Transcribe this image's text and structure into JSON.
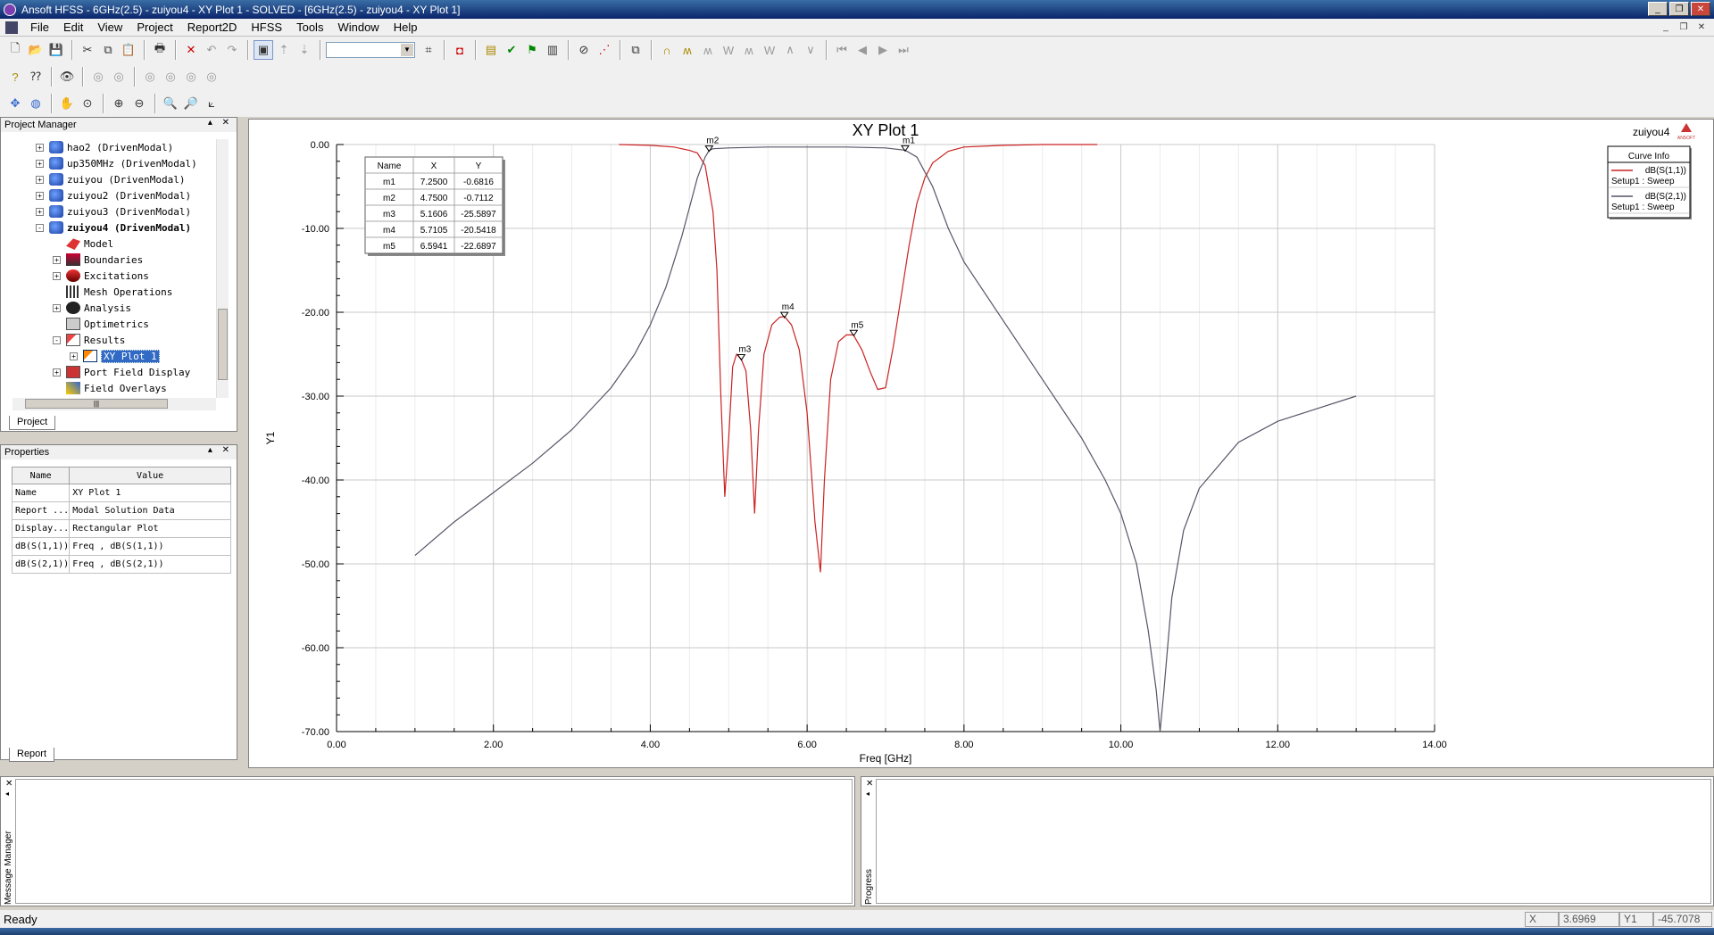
{
  "window": {
    "title": "Ansoft HFSS - 6GHz(2.5) - zuiyou4 - XY Plot 1 - SOLVED - [6GHz(2.5) - zuiyou4 - XY Plot 1]"
  },
  "menu": [
    "File",
    "Edit",
    "View",
    "Project",
    "Report2D",
    "HFSS",
    "Tools",
    "Window",
    "Help"
  ],
  "project_manager": {
    "title": "Project Manager",
    "tab": "Project",
    "items": [
      {
        "label": "hao2 (DrivenModal)",
        "icon": "solid-icon",
        "level": 0,
        "exp": "+"
      },
      {
        "label": "up350MHz (DrivenModal)",
        "icon": "solid-icon",
        "level": 0,
        "exp": "+"
      },
      {
        "label": "zuiyou (DrivenModal)",
        "icon": "solid-icon",
        "level": 0,
        "exp": "+"
      },
      {
        "label": "zuiyou2 (DrivenModal)",
        "icon": "solid-icon",
        "level": 0,
        "exp": "+"
      },
      {
        "label": "zuiyou3 (DrivenModal)",
        "icon": "solid-icon",
        "level": 0,
        "exp": "+"
      },
      {
        "label": "zuiyou4 (DrivenModal)",
        "icon": "solid-icon",
        "level": 0,
        "exp": "-",
        "bold": true
      },
      {
        "label": "Model",
        "icon": "model-icon",
        "level": 1,
        "exp": ""
      },
      {
        "label": "Boundaries",
        "icon": "boundaries-icon",
        "level": 1,
        "exp": "+"
      },
      {
        "label": "Excitations",
        "icon": "excitations-icon",
        "level": 1,
        "exp": "+"
      },
      {
        "label": "Mesh Operations",
        "icon": "mesh-icon",
        "level": 1,
        "exp": ""
      },
      {
        "label": "Analysis",
        "icon": "analysis-icon",
        "level": 1,
        "exp": "+"
      },
      {
        "label": "Optimetrics",
        "icon": "optimetrics-icon",
        "level": 1,
        "exp": ""
      },
      {
        "label": "Results",
        "icon": "results-icon",
        "level": 1,
        "exp": "-"
      },
      {
        "label": "XY Plot 1",
        "icon": "xy-plot-icon",
        "level": 2,
        "exp": "+",
        "selected": true
      },
      {
        "label": "Port Field Display",
        "icon": "port-field-icon",
        "level": 1,
        "exp": "+"
      },
      {
        "label": "Field Overlays",
        "icon": "field-overlays-icon",
        "level": 1,
        "exp": ""
      }
    ]
  },
  "properties": {
    "title": "Properties",
    "tab": "Report",
    "headers": [
      "Name",
      "Value"
    ],
    "rows": [
      [
        "Name",
        "XY Plot 1"
      ],
      [
        "Report ...",
        "Modal Solution Data"
      ],
      [
        "Display...",
        "Rectangular Plot"
      ],
      [
        "dB(S(1,1))",
        "Freq , dB(S(1,1))"
      ],
      [
        "dB(S(2,1))",
        "Freq , dB(S(2,1))"
      ]
    ]
  },
  "plot": {
    "title": "XY Plot 1",
    "design_label": "zuiyou4",
    "logo_text": "ANSOFT",
    "xlabel": "Freq [GHz]",
    "ylabel": "Y1",
    "curve_info_title": "Curve Info",
    "marker_table": {
      "headers": [
        "Name",
        "X",
        "Y"
      ],
      "rows": [
        [
          "m1",
          "7.2500",
          "-0.6816"
        ],
        [
          "m2",
          "4.7500",
          "-0.7112"
        ],
        [
          "m3",
          "5.1606",
          "-25.5897"
        ],
        [
          "m4",
          "5.7105",
          "-20.5418"
        ],
        [
          "m5",
          "6.5941",
          "-22.6897"
        ]
      ]
    }
  },
  "chart_data": {
    "type": "line",
    "title": "XY Plot 1",
    "xlabel": "Freq [GHz]",
    "ylabel": "Y1",
    "xlim": [
      0,
      14
    ],
    "ylim": [
      -70,
      0
    ],
    "xticks": [
      "0.00",
      "2.00",
      "4.00",
      "6.00",
      "8.00",
      "10.00",
      "12.00",
      "14.00"
    ],
    "yticks": [
      "0.00",
      "-10.00",
      "-20.00",
      "-30.00",
      "-40.00",
      "-50.00",
      "-60.00",
      "-70.00"
    ],
    "grid": true,
    "legend_position": "top-right",
    "series": [
      {
        "name": "dB(S(1,1))",
        "sub": "Setup1 : Sweep",
        "color": "#cc2222",
        "x": [
          3.6,
          4.0,
          4.3,
          4.5,
          4.6,
          4.7,
          4.8,
          4.85,
          4.9,
          4.95,
          5.0,
          5.05,
          5.1,
          5.16,
          5.22,
          5.28,
          5.33,
          5.38,
          5.45,
          5.55,
          5.65,
          5.71,
          5.8,
          5.9,
          6.0,
          6.1,
          6.17,
          6.22,
          6.3,
          6.4,
          6.5,
          6.59,
          6.7,
          6.8,
          6.9,
          7.0,
          7.1,
          7.2,
          7.3,
          7.4,
          7.5,
          7.6,
          7.8,
          8.0,
          8.5,
          9.0,
          9.7
        ],
        "y": [
          0,
          -0.1,
          -0.3,
          -0.7,
          -1.0,
          -2.5,
          -8.0,
          -15.0,
          -30.0,
          -42.0,
          -35.0,
          -26.5,
          -25.0,
          -25.6,
          -27.0,
          -34.0,
          -44.0,
          -34.0,
          -25.0,
          -21.5,
          -20.6,
          -20.5,
          -21.5,
          -24.5,
          -32.0,
          -45.0,
          -51.0,
          -40.0,
          -28.0,
          -23.5,
          -22.7,
          -22.7,
          -24.5,
          -27.0,
          -29.2,
          -29.0,
          -24.0,
          -18.0,
          -12.0,
          -7.0,
          -4.0,
          -2.2,
          -0.8,
          -0.3,
          -0.1,
          0,
          0
        ]
      },
      {
        "name": "dB(S(2,1))",
        "sub": "Setup1 : Sweep",
        "color": "#555566",
        "x": [
          1.0,
          1.5,
          2.0,
          2.5,
          3.0,
          3.5,
          3.8,
          4.0,
          4.2,
          4.4,
          4.5,
          4.6,
          4.7,
          4.75,
          4.8,
          5.0,
          5.5,
          6.0,
          6.5,
          7.0,
          7.25,
          7.4,
          7.6,
          7.8,
          8.0,
          8.5,
          9.0,
          9.5,
          9.8,
          10.0,
          10.2,
          10.35,
          10.45,
          10.5,
          10.55,
          10.65,
          10.8,
          11.0,
          11.5,
          12.0,
          12.5,
          13.0
        ],
        "y": [
          -49.0,
          -45.0,
          -41.5,
          -38.0,
          -34.0,
          -29.0,
          -25.0,
          -21.5,
          -17.0,
          -11.0,
          -7.5,
          -4.0,
          -1.5,
          -0.71,
          -0.5,
          -0.4,
          -0.3,
          -0.3,
          -0.3,
          -0.4,
          -0.68,
          -1.5,
          -5.0,
          -10.0,
          -14.0,
          -21.0,
          -28.0,
          -35.0,
          -40.0,
          -44.0,
          -50.0,
          -58.0,
          -65.0,
          -70.0,
          -65.0,
          -54.0,
          -46.0,
          -41.0,
          -35.5,
          -33.0,
          -31.5,
          -30.0
        ]
      }
    ],
    "markers": [
      {
        "name": "m1",
        "x": 7.25,
        "y": -0.6816
      },
      {
        "name": "m2",
        "x": 4.75,
        "y": -0.7112
      },
      {
        "name": "m3",
        "x": 5.1606,
        "y": -25.5897
      },
      {
        "name": "m4",
        "x": 5.7105,
        "y": -20.5418
      },
      {
        "name": "m5",
        "x": 6.5941,
        "y": -22.6897
      }
    ]
  },
  "bottom": {
    "message_label": "Message Manager",
    "progress_label": "Progress"
  },
  "status": {
    "text": "Ready",
    "x_label": "X",
    "x_value": "3.6969",
    "y_label": "Y1",
    "y_value": "-45.7078"
  }
}
